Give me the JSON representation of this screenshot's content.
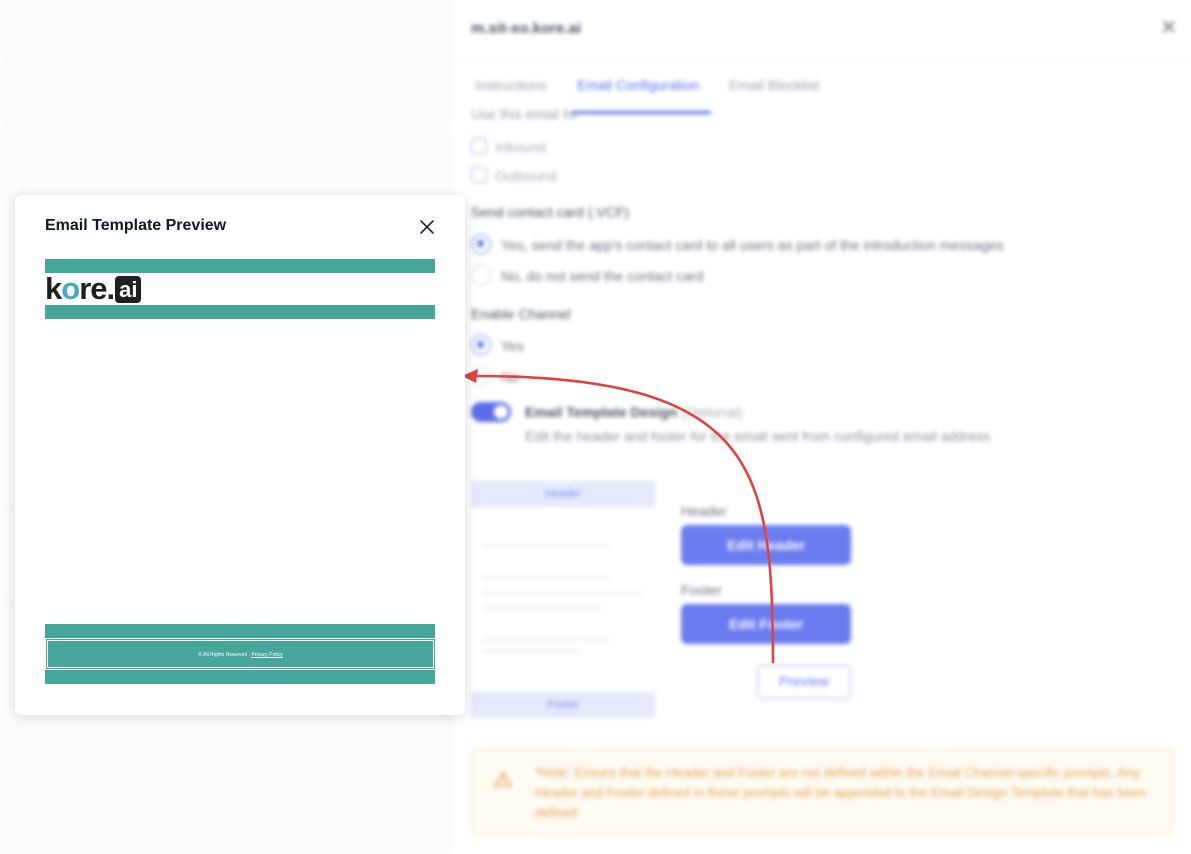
{
  "background": {
    "panel_title": "m.sit-xo.kore.ai",
    "tabs": [
      {
        "label": "Instructions"
      },
      {
        "label": "Email Configuration"
      },
      {
        "label": "Email Blocklist"
      }
    ],
    "use_email_for_label": "Use this email for",
    "use_for_options": [
      {
        "label": "Inbound"
      },
      {
        "label": "Outbound"
      }
    ],
    "contact_card": {
      "title": "Send contact card (.VCF)",
      "options": [
        {
          "label": "Yes, send the app's contact card to all users as part of the introduction messages"
        },
        {
          "label": "No, do not send the contact card"
        }
      ]
    },
    "enable_channel": {
      "title": "Enable Channel",
      "options": [
        {
          "label": "Yes"
        },
        {
          "label": "No"
        }
      ]
    },
    "template_design": {
      "title": "Email Template Design",
      "optional": "(Optional)",
      "description": "Edit the header and footer for the email sent from configured email address"
    },
    "mock": {
      "header": "Header",
      "footer": "Footer"
    },
    "header_label": "Header",
    "edit_header_button": "Edit Header",
    "footer_label": "Footer",
    "edit_footer_button": "Edit Footer",
    "preview_button": "Preview",
    "note": "*Note: Ensure that the Header and Footer are not defined within the Email Channel-specific prompts. Any Header and Footer defined in these prompts will be appended to the Email Design Template that has been defined"
  },
  "modal": {
    "title": "Email Template Preview",
    "logo": {
      "kore_k": "k",
      "kore_o": "o",
      "kore_re": "re",
      "dot": ".",
      "ai": "ai"
    },
    "footer_text": "© All Rights Reserved · ",
    "footer_link": "Privacy Policy"
  },
  "colors": {
    "accent": "#5b6ee8",
    "template_bar": "#47a69c",
    "arrow": "#e04343",
    "note_text": "#e5a55a"
  }
}
